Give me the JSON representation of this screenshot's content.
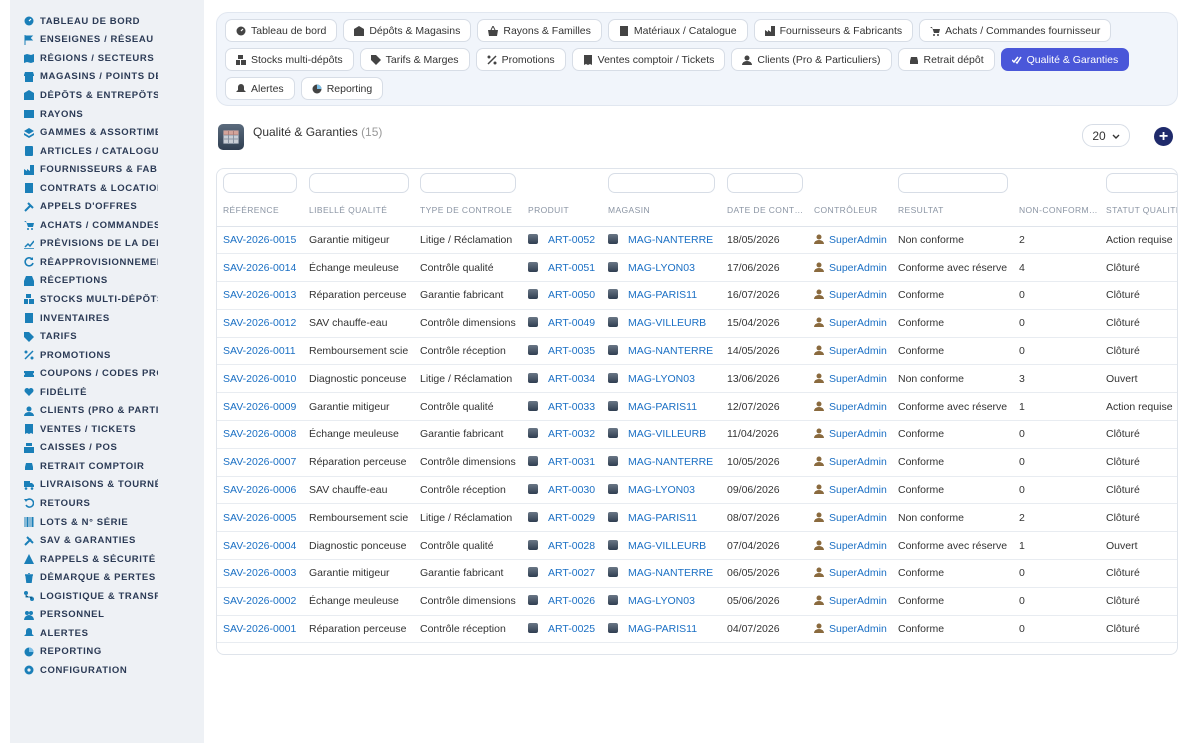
{
  "sidebar": {
    "items": [
      {
        "label": "TABLEAU DE BORD",
        "icon": "dashboard-icon"
      },
      {
        "label": "ENSEIGNES / RÉSEAU",
        "icon": "flag-icon"
      },
      {
        "label": "RÉGIONS / SECTEURS",
        "icon": "map-icon"
      },
      {
        "label": "MAGASINS / POINTS DE V",
        "icon": "store-icon"
      },
      {
        "label": "DÉPÔTS & ENTREPÔTS",
        "icon": "warehouse-icon"
      },
      {
        "label": "RAYONS",
        "icon": "shelf-icon"
      },
      {
        "label": "GAMMES & ASSORTIMEN",
        "icon": "layers-icon"
      },
      {
        "label": "ARTICLES / CATALOGUE",
        "icon": "book-icon"
      },
      {
        "label": "FOURNISSEURS & FABRI",
        "icon": "industry-icon"
      },
      {
        "label": "CONTRATS & LOCATION",
        "icon": "contract-icon"
      },
      {
        "label": "APPELS D'OFFRES",
        "icon": "gavel-icon"
      },
      {
        "label": "ACHATS / COMMANDES F",
        "icon": "cart-icon"
      },
      {
        "label": "PRÉVISIONS DE LA DEMA",
        "icon": "chart-icon"
      },
      {
        "label": "RÉAPPROVISIONNEMENT",
        "icon": "refresh-icon"
      },
      {
        "label": "RÉCEPTIONS",
        "icon": "inbox-icon"
      },
      {
        "label": "STOCKS MULTI-DÉPÔTS",
        "icon": "boxes-icon"
      },
      {
        "label": "INVENTAIRES",
        "icon": "list-icon"
      },
      {
        "label": "TARIFS",
        "icon": "tag-icon"
      },
      {
        "label": "PROMOTIONS",
        "icon": "percent-icon"
      },
      {
        "label": "COUPONS / CODES PROM",
        "icon": "ticket-icon"
      },
      {
        "label": "FIDÉLITÉ",
        "icon": "heart-icon"
      },
      {
        "label": "CLIENTS (PRO & PARTICU",
        "icon": "user-icon"
      },
      {
        "label": "VENTES / TICKETS",
        "icon": "receipt-icon"
      },
      {
        "label": "CAISSES / POS",
        "icon": "cash-register-icon"
      },
      {
        "label": "RETRAIT COMPTOIR",
        "icon": "car-icon"
      },
      {
        "label": "LIVRAISONS & TOURNÉES",
        "icon": "truck-icon"
      },
      {
        "label": "RETOURS",
        "icon": "undo-icon"
      },
      {
        "label": "LOTS & N° SÉRIE",
        "icon": "barcode-icon"
      },
      {
        "label": "SAV & GARANTIES",
        "icon": "tools-icon"
      },
      {
        "label": "RAPPELS & SÉCURITÉ",
        "icon": "warning-icon"
      },
      {
        "label": "DÉMARQUE & PERTES",
        "icon": "trash-icon"
      },
      {
        "label": "LOGISTIQUE & TRANSPO",
        "icon": "route-icon"
      },
      {
        "label": "PERSONNEL",
        "icon": "users-icon"
      },
      {
        "label": "ALERTES",
        "icon": "bell-icon"
      },
      {
        "label": "REPORTING",
        "icon": "report-icon"
      },
      {
        "label": "CONFIGURATION",
        "icon": "gear-icon"
      }
    ]
  },
  "tabs": [
    {
      "label": "Tableau de bord",
      "icon": "dashboard-icon",
      "active": false
    },
    {
      "label": "Dépôts & Magasins",
      "icon": "warehouse-icon",
      "active": false
    },
    {
      "label": "Rayons & Familles",
      "icon": "basket-icon",
      "active": false
    },
    {
      "label": "Matériaux / Catalogue",
      "icon": "catalog-icon",
      "active": false
    },
    {
      "label": "Fournisseurs & Fabricants",
      "icon": "industry-icon",
      "active": false
    },
    {
      "label": "Achats / Commandes fournisseur",
      "icon": "cart-icon",
      "active": false
    },
    {
      "label": "Stocks multi-dépôts",
      "icon": "boxes-icon",
      "active": false
    },
    {
      "label": "Tarifs & Marges",
      "icon": "tag-icon",
      "active": false
    },
    {
      "label": "Promotions",
      "icon": "percent-icon",
      "active": false
    },
    {
      "label": "Ventes comptoir / Tickets",
      "icon": "receipt-icon",
      "active": false
    },
    {
      "label": "Clients (Pro & Particuliers)",
      "icon": "user-icon",
      "active": false
    },
    {
      "label": "Retrait dépôt",
      "icon": "car-icon",
      "active": false
    },
    {
      "label": "Qualité & Garanties",
      "icon": "check-double-icon",
      "active": true
    },
    {
      "label": "Alertes",
      "icon": "bell-icon",
      "active": false
    },
    {
      "label": "Reporting",
      "icon": "report-icon",
      "active": false
    }
  ],
  "page": {
    "title": "Qualité & Garanties",
    "count": "(15)",
    "per_page": "20",
    "add_label": "+"
  },
  "table": {
    "columns": [
      "RÉFÉRENCE",
      "LIBELLÉ QUALITÉ",
      "TYPE DE CONTROLE",
      "PRODUIT",
      "MAGASIN",
      "DATE DE CONT…",
      "CONTRÔLEUR",
      "RESULTAT",
      "NON-CONFORM…",
      "STATUT QUALITÉ"
    ],
    "rows": [
      [
        "SAV-2026-0015",
        "Garantie mitigeur",
        "Litige / Réclamation",
        "ART-0052",
        "MAG-NANTERRE",
        "18/05/2026",
        "SuperAdmin",
        "Non conforme",
        "2",
        "Action requise"
      ],
      [
        "SAV-2026-0014",
        "Échange meuleuse",
        "Contrôle qualité",
        "ART-0051",
        "MAG-LYON03",
        "17/06/2026",
        "SuperAdmin",
        "Conforme avec réserve",
        "4",
        "Clôturé"
      ],
      [
        "SAV-2026-0013",
        "Réparation perceuse",
        "Garantie fabricant",
        "ART-0050",
        "MAG-PARIS11",
        "16/07/2026",
        "SuperAdmin",
        "Conforme",
        "0",
        "Clôturé"
      ],
      [
        "SAV-2026-0012",
        "SAV chauffe-eau",
        "Contrôle dimensions",
        "ART-0049",
        "MAG-VILLEURB",
        "15/04/2026",
        "SuperAdmin",
        "Conforme",
        "0",
        "Clôturé"
      ],
      [
        "SAV-2026-0011",
        "Remboursement scie",
        "Contrôle réception",
        "ART-0035",
        "MAG-NANTERRE",
        "14/05/2026",
        "SuperAdmin",
        "Conforme",
        "0",
        "Clôturé"
      ],
      [
        "SAV-2026-0010",
        "Diagnostic ponceuse",
        "Litige / Réclamation",
        "ART-0034",
        "MAG-LYON03",
        "13/06/2026",
        "SuperAdmin",
        "Non conforme",
        "3",
        "Ouvert"
      ],
      [
        "SAV-2026-0009",
        "Garantie mitigeur",
        "Contrôle qualité",
        "ART-0033",
        "MAG-PARIS11",
        "12/07/2026",
        "SuperAdmin",
        "Conforme avec réserve",
        "1",
        "Action requise"
      ],
      [
        "SAV-2026-0008",
        "Échange meuleuse",
        "Garantie fabricant",
        "ART-0032",
        "MAG-VILLEURB",
        "11/04/2026",
        "SuperAdmin",
        "Conforme",
        "0",
        "Clôturé"
      ],
      [
        "SAV-2026-0007",
        "Réparation perceuse",
        "Contrôle dimensions",
        "ART-0031",
        "MAG-NANTERRE",
        "10/05/2026",
        "SuperAdmin",
        "Conforme",
        "0",
        "Clôturé"
      ],
      [
        "SAV-2026-0006",
        "SAV chauffe-eau",
        "Contrôle réception",
        "ART-0030",
        "MAG-LYON03",
        "09/06/2026",
        "SuperAdmin",
        "Conforme",
        "0",
        "Clôturé"
      ],
      [
        "SAV-2026-0005",
        "Remboursement scie",
        "Litige / Réclamation",
        "ART-0029",
        "MAG-PARIS11",
        "08/07/2026",
        "SuperAdmin",
        "Non conforme",
        "2",
        "Clôturé"
      ],
      [
        "SAV-2026-0004",
        "Diagnostic ponceuse",
        "Contrôle qualité",
        "ART-0028",
        "MAG-VILLEURB",
        "07/04/2026",
        "SuperAdmin",
        "Conforme avec réserve",
        "1",
        "Ouvert"
      ],
      [
        "SAV-2026-0003",
        "Garantie mitigeur",
        "Garantie fabricant",
        "ART-0027",
        "MAG-NANTERRE",
        "06/05/2026",
        "SuperAdmin",
        "Conforme",
        "0",
        "Clôturé"
      ],
      [
        "SAV-2026-0002",
        "Échange meuleuse",
        "Contrôle dimensions",
        "ART-0026",
        "MAG-LYON03",
        "05/06/2026",
        "SuperAdmin",
        "Conforme",
        "0",
        "Clôturé"
      ],
      [
        "SAV-2026-0001",
        "Réparation perceuse",
        "Contrôle réception",
        "ART-0025",
        "MAG-PARIS11",
        "04/07/2026",
        "SuperAdmin",
        "Conforme",
        "0",
        "Clôturé"
      ]
    ]
  },
  "colors": {
    "accent": "#4a57d9",
    "link": "#1a6fc4",
    "sidebar_icon": "#1a7fb8",
    "sidebar_text": "#2b3a55"
  }
}
